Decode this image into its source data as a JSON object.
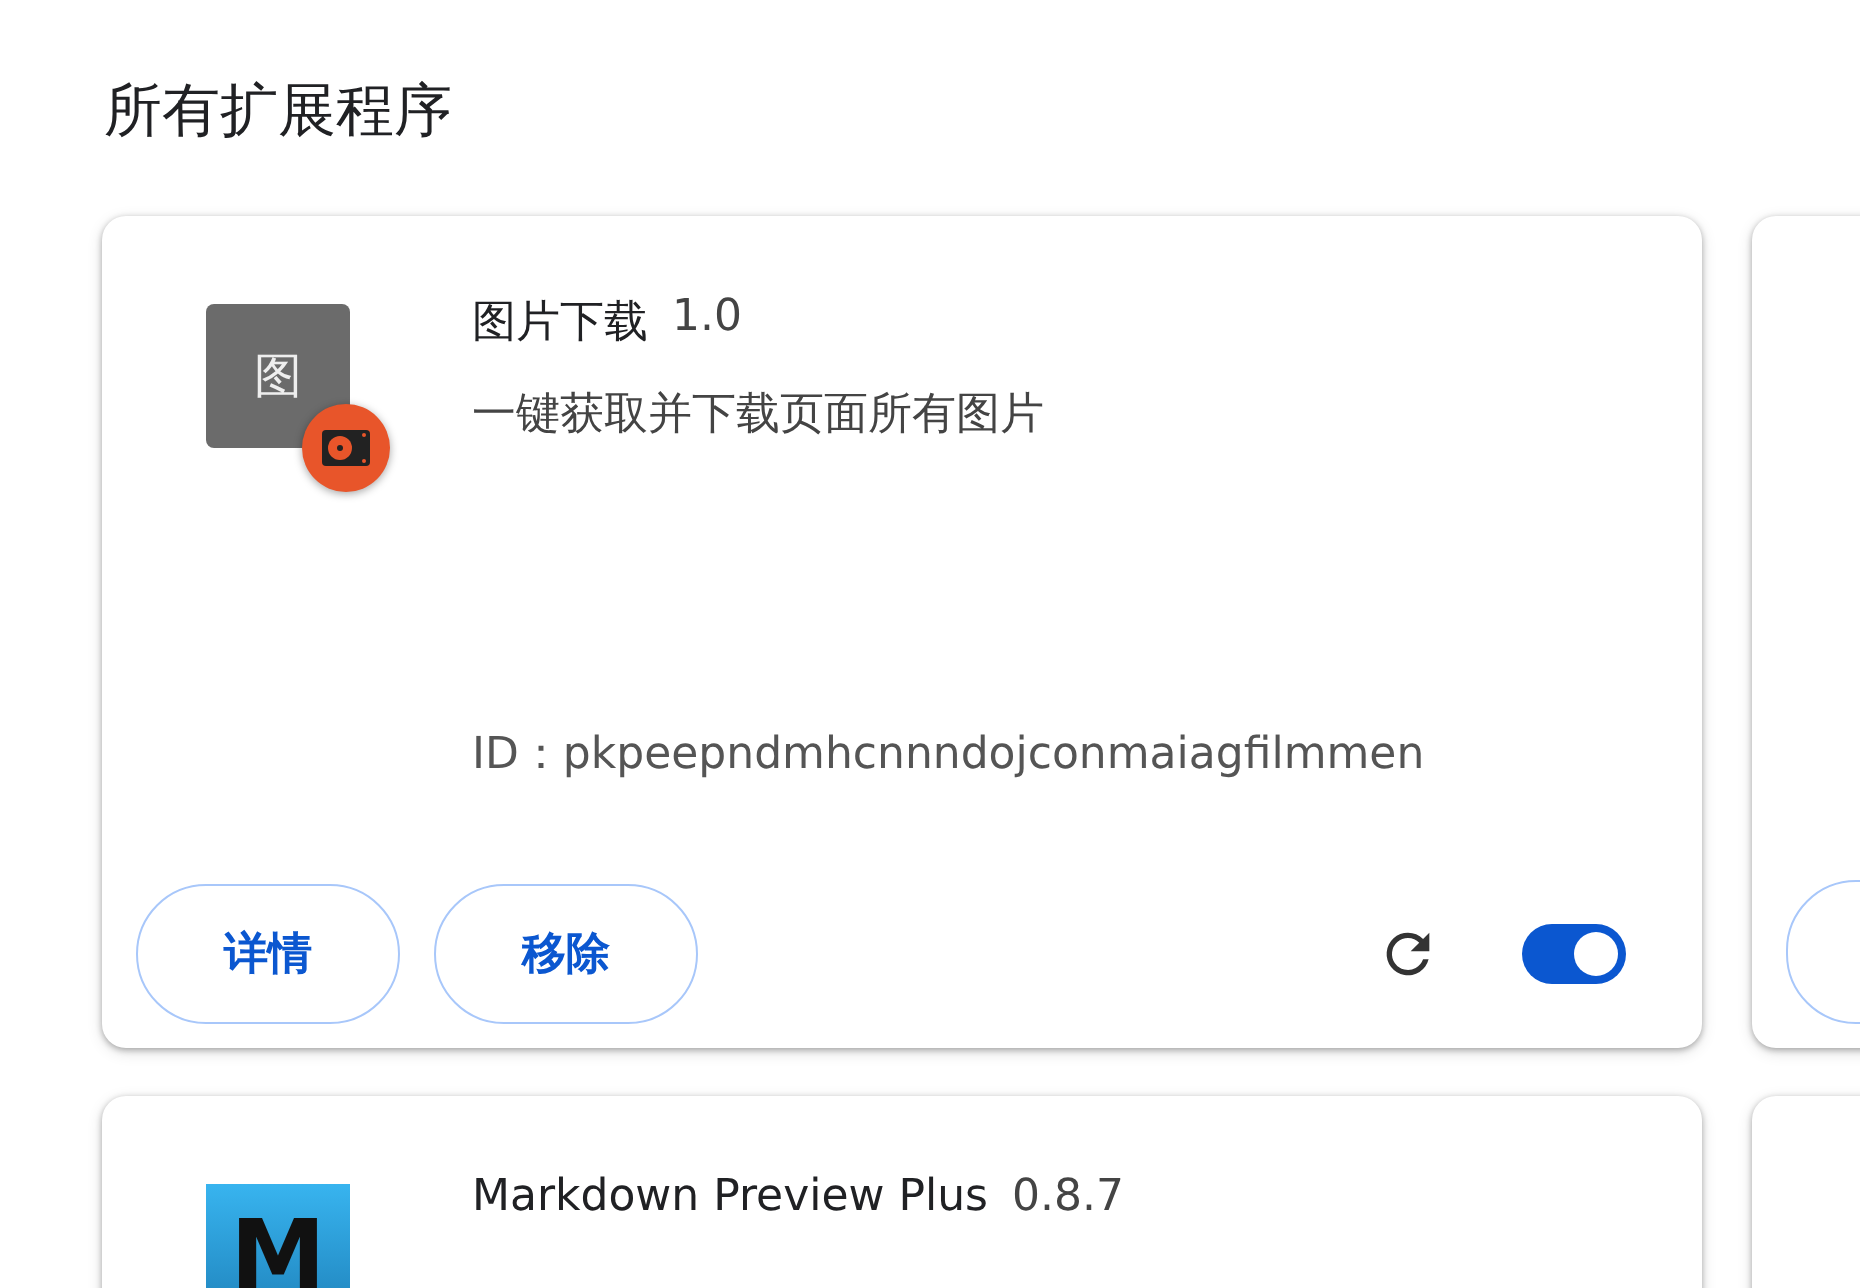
{
  "section_title": "所有扩展程序",
  "extensions": [
    {
      "name": "图片下载",
      "version": "1.0",
      "icon": {
        "kind": "glyph",
        "text": "图",
        "badge": true
      },
      "description": "一键获取并下载页面所有图片",
      "id_label": "ID：",
      "id": "pkpeepndmhcnnndojconmaiagfilmmen",
      "buttons": [
        "详情",
        "移除"
      ],
      "enabled": true
    },
    {
      "name": "Markdown Preview Plus",
      "version": "0.8.7",
      "icon": {
        "kind": "letter",
        "text": "M",
        "badge": false
      }
    }
  ]
}
